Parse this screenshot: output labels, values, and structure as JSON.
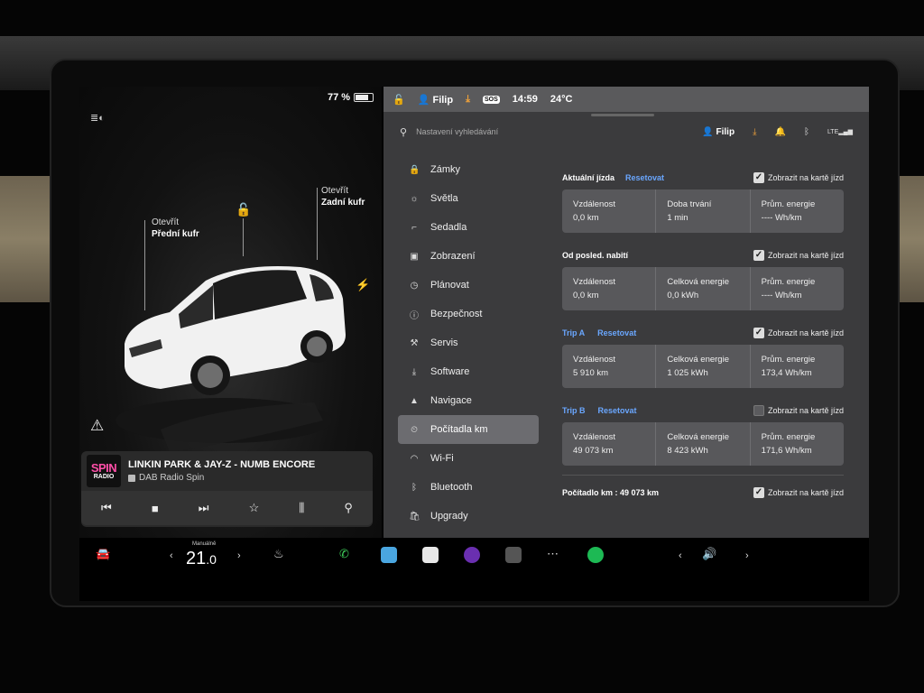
{
  "status": {
    "battery": "77 %",
    "battery_level": 0.77
  },
  "car": {
    "frunk_label_1": "Otevřít",
    "frunk_label_2": "Přední kufr",
    "trunk_label_1": "Otevřít",
    "trunk_label_2": "Zadní kufr"
  },
  "media": {
    "logo_top": "SPIN",
    "logo_bottom": "RADIO",
    "song": "LINKIN PARK & JAY-Z - NUMB ENCORE",
    "station": "DAB Radio Spin",
    "controls": [
      "⏮",
      "■",
      "⏭",
      "☆",
      "⫼",
      "⚲"
    ]
  },
  "topbar": {
    "user": "Filip",
    "time": "14:59",
    "temp": "24°C",
    "sos": "SOS"
  },
  "search": {
    "placeholder": "Nastavení vyhledávání"
  },
  "header_icons": {
    "user": "Filip",
    "lte": "LTE"
  },
  "nav": [
    {
      "label": "Zámky",
      "icon": "🔒"
    },
    {
      "label": "Světla",
      "icon": "☼"
    },
    {
      "label": "Sedadla",
      "icon": "⌐"
    },
    {
      "label": "Zobrazení",
      "icon": "▣"
    },
    {
      "label": "Plánovat",
      "icon": "◷"
    },
    {
      "label": "Bezpečnost",
      "icon": "ⓘ"
    },
    {
      "label": "Servis",
      "icon": "⚒"
    },
    {
      "label": "Software",
      "icon": "⤓"
    },
    {
      "label": "Navigace",
      "icon": "▲"
    },
    {
      "label": "Počítadla km",
      "icon": "⏲"
    },
    {
      "label": "Wi-Fi",
      "icon": "◠"
    },
    {
      "label": "Bluetooth",
      "icon": "ᛒ"
    },
    {
      "label": "Upgrady",
      "icon": "🛍"
    }
  ],
  "active_nav": 9,
  "trips": {
    "current": {
      "title": "Aktuální jízda",
      "reset": "Resetovat",
      "show": "Zobrazit na kartě jízd",
      "checked": true,
      "cells": [
        {
          "label": "Vzdálenost",
          "value": "0,0  km"
        },
        {
          "label": "Doba trvání",
          "value": "1 min"
        },
        {
          "label": "Prům. energie",
          "value": "----  Wh/km"
        }
      ]
    },
    "since_charge": {
      "title": "Od posled. nabití",
      "show": "Zobrazit na kartě jízd",
      "checked": true,
      "cells": [
        {
          "label": "Vzdálenost",
          "value": "0,0  km"
        },
        {
          "label": "Celková energie",
          "value": "0,0  kWh"
        },
        {
          "label": "Prům. energie",
          "value": "----  Wh/km"
        }
      ]
    },
    "trip_a": {
      "title": "Trip A",
      "reset": "Resetovat",
      "show": "Zobrazit na kartě jízd",
      "checked": true,
      "cells": [
        {
          "label": "Vzdálenost",
          "value": "5 910  km"
        },
        {
          "label": "Celková energie",
          "value": "1 025  kWh"
        },
        {
          "label": "Prům. energie",
          "value": "173,4  Wh/km"
        }
      ]
    },
    "trip_b": {
      "title": "Trip B",
      "reset": "Resetovat",
      "show": "Zobrazit na kartě jízd",
      "checked": false,
      "cells": [
        {
          "label": "Vzdálenost",
          "value": "49 073  km"
        },
        {
          "label": "Celková energie",
          "value": "8 423  kWh"
        },
        {
          "label": "Prům. energie",
          "value": "171,6  Wh/km"
        }
      ]
    }
  },
  "odometer": {
    "label": "Počítadlo km :  49 073  km",
    "show": "Zobrazit na kartě jízd",
    "checked": true
  },
  "bottom": {
    "climate_mode": "Manuálně",
    "temp_int": "21",
    "temp_dec": ".0",
    "left_arrow": "‹",
    "right_arrow": "›"
  }
}
